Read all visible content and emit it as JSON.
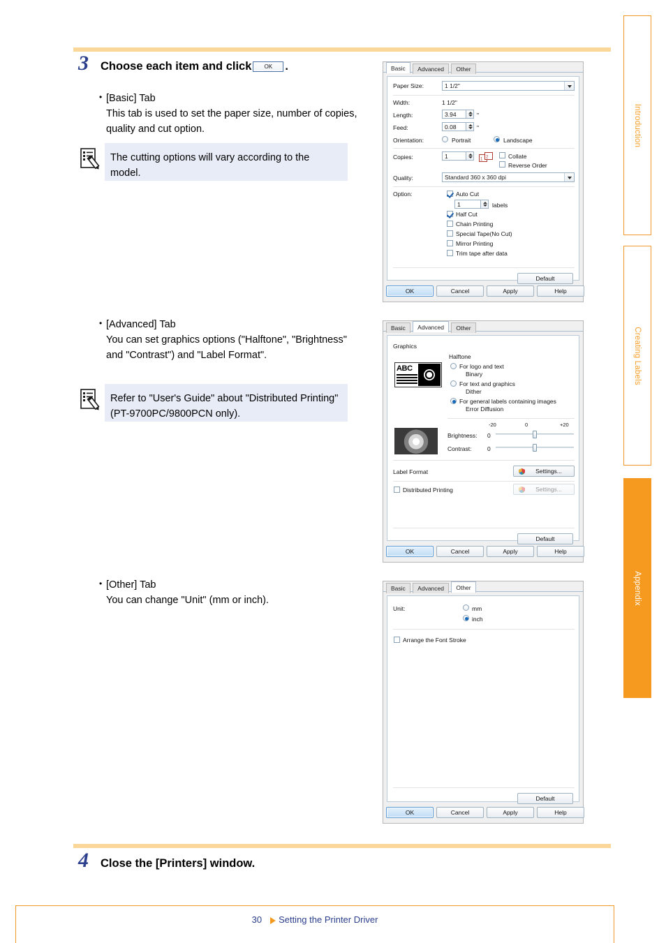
{
  "page": {
    "number": "30",
    "footer_label": "Setting the Printer Driver"
  },
  "sidebar": {
    "tabs": [
      {
        "label": "Introduction",
        "active": false
      },
      {
        "label": "Creating Labels",
        "active": false
      },
      {
        "label": "Appendix",
        "active": true
      }
    ]
  },
  "steps": [
    {
      "number": "3",
      "text_before": "Choose each item and click",
      "inline_button": "OK",
      "text_after": "."
    },
    {
      "number": "4",
      "text_before": "Close the [Printers] window.",
      "inline_button": "",
      "text_after": ""
    }
  ],
  "sections": {
    "basic": {
      "heading": "[Basic] Tab",
      "body": "This tab is used to set the paper size, number of copies, quality and cut option.",
      "note": "The cutting options will vary according to the model."
    },
    "advanced": {
      "heading": "[Advanced] Tab",
      "body": "You can set graphics options (\"Halftone\", \"Brightness\" and \"Contrast\") and \"Label Format\".",
      "note": "Refer to \"User's Guide\" about \"Distributed Printing\" (PT-9700PC/9800PCN only)."
    },
    "other": {
      "heading": "[Other] Tab",
      "body": "You can change \"Unit\" (mm or inch)."
    }
  },
  "dialogs": {
    "basic": {
      "tabs": [
        {
          "label": "Basic",
          "selected": true
        },
        {
          "label": "Advanced",
          "selected": false
        },
        {
          "label": "Other",
          "selected": false
        }
      ],
      "fields": {
        "paper_size_label": "Paper Size:",
        "paper_size_value": "1 1/2\"",
        "width_label": "Width:",
        "width_value": "1 1/2\"",
        "length_label": "Length:",
        "length_value": "3.94",
        "length_unit": "\"",
        "feed_label": "Feed:",
        "feed_value": "0.08",
        "feed_unit": "\"",
        "orientation_label": "Orientation:",
        "orientation_portrait": "Portrait",
        "orientation_landscape": "Landscape",
        "copies_label": "Copies:",
        "copies_value": "1",
        "collate": "Collate",
        "reverse_order": "Reverse Order",
        "quality_label": "Quality:",
        "quality_value": "Standard 360 x 360 dpi",
        "option_label": "Option:",
        "auto_cut": "Auto Cut",
        "auto_cut_count": "1",
        "auto_cut_unit": "labels",
        "half_cut": "Half Cut",
        "chain_printing": "Chain Printing",
        "special_tape": "Special Tape(No Cut)",
        "mirror_printing": "Mirror Printing",
        "trim_tape": "Trim tape after data"
      },
      "buttons": {
        "default": "Default",
        "ok": "OK",
        "cancel": "Cancel",
        "apply": "Apply",
        "help": "Help"
      }
    },
    "advanced": {
      "tabs": [
        {
          "label": "Basic",
          "selected": false
        },
        {
          "label": "Advanced",
          "selected": true
        },
        {
          "label": "Other",
          "selected": false
        }
      ],
      "fields": {
        "graphics_label": "Graphics",
        "halftone_label": "Halftone",
        "halftone_opt1": "For logo and text",
        "halftone_opt1_sub": "Binary",
        "halftone_opt2": "For text and graphics",
        "halftone_opt2_sub": "Dither",
        "halftone_opt3": "For general labels containing images",
        "halftone_opt3_sub": "Error Diffusion",
        "tick_min": "-20",
        "tick_mid": "0",
        "tick_max": "+20",
        "brightness_label": "Brightness:",
        "brightness_value": "0",
        "contrast_label": "Contrast:",
        "contrast_value": "0",
        "label_format_label": "Label Format",
        "label_format_button": "Settings...",
        "distributed_printing": "Distributed Printing",
        "distributed_printing_button": "Settings...",
        "preview_abc": "ABC"
      },
      "buttons": {
        "default": "Default",
        "ok": "OK",
        "cancel": "Cancel",
        "apply": "Apply",
        "help": "Help"
      }
    },
    "other": {
      "tabs": [
        {
          "label": "Basic",
          "selected": false
        },
        {
          "label": "Advanced",
          "selected": false
        },
        {
          "label": "Other",
          "selected": true
        }
      ],
      "fields": {
        "unit_label": "Unit:",
        "unit_mm": "mm",
        "unit_inch": "inch",
        "arrange_font_stroke": "Arrange the Font Stroke"
      },
      "buttons": {
        "default": "Default",
        "ok": "OK",
        "cancel": "Cancel",
        "apply": "Apply",
        "help": "Help"
      }
    }
  },
  "colors": {
    "accent_orange": "#f59a1e",
    "rule_orange": "#fbd79a",
    "step_blue": "#2b3f8c",
    "note_bg": "#e8ecf6"
  }
}
